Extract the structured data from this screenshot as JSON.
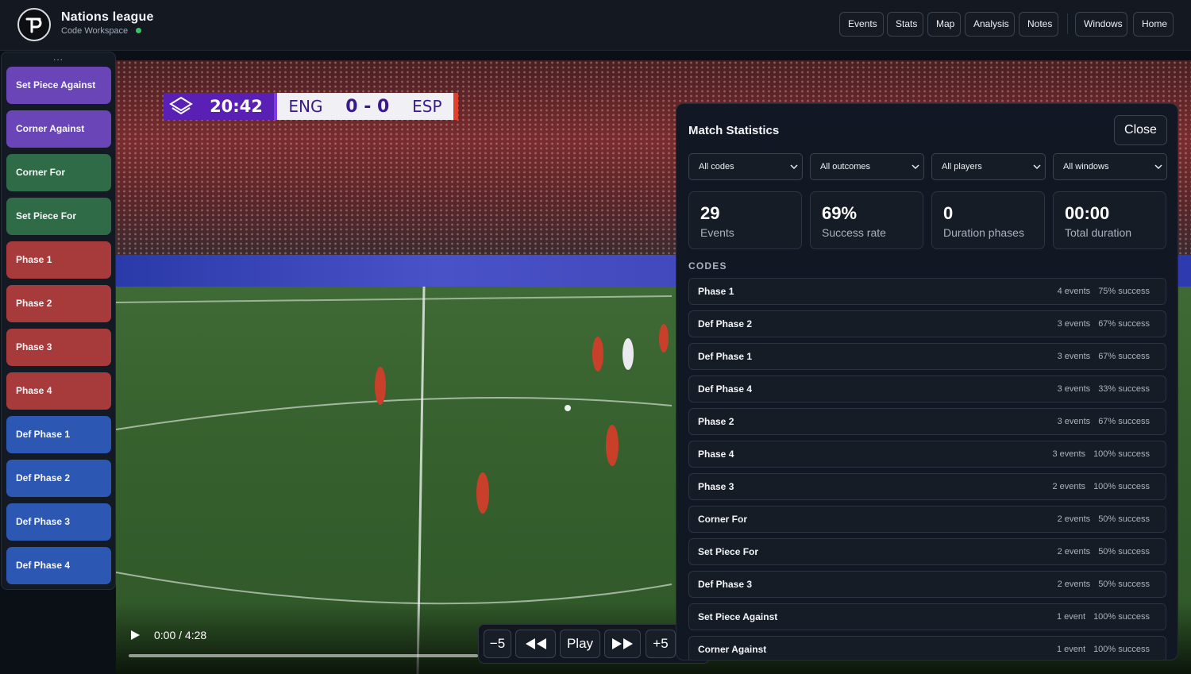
{
  "app": {
    "title": "Nations league",
    "subtitle": "Code Workspace"
  },
  "nav": [
    "Events",
    "Stats",
    "Map",
    "Analysis",
    "Notes",
    "Windows",
    "Home"
  ],
  "sidebar": {
    "handle": "...",
    "items": [
      {
        "label": "Set Piece Against",
        "color": "#6a45b8"
      },
      {
        "label": "Corner Against",
        "color": "#6a45b8"
      },
      {
        "label": "Corner For",
        "color": "#2f6b47"
      },
      {
        "label": "Set Piece For",
        "color": "#2f6b47"
      },
      {
        "label": "Phase 1",
        "color": "#a73b3b"
      },
      {
        "label": "Phase 2",
        "color": "#a73b3b"
      },
      {
        "label": "Phase 3",
        "color": "#a73b3b"
      },
      {
        "label": "Phase 4",
        "color": "#a73b3b"
      },
      {
        "label": "Def Phase 1",
        "color": "#2c58b4"
      },
      {
        "label": "Def Phase 2",
        "color": "#2c58b4"
      },
      {
        "label": "Def Phase 3",
        "color": "#2c58b4"
      },
      {
        "label": "Def Phase 4",
        "color": "#2c58b4"
      }
    ]
  },
  "video": {
    "scoreboard": {
      "clock": "20:42",
      "home": "ENG",
      "score": "0 - 0",
      "away": "ESP"
    },
    "time": "0:00 / 4:28",
    "controls": {
      "back": "−5",
      "play": "Play",
      "forward": "+5"
    }
  },
  "stats": {
    "title": "Match Statistics",
    "close": "Close",
    "filters": [
      "All codes",
      "All outcomes",
      "All players",
      "All windows"
    ],
    "cards": [
      {
        "value": "29",
        "label": "Events"
      },
      {
        "value": "69%",
        "label": "Success rate"
      },
      {
        "value": "0",
        "label": "Duration phases"
      },
      {
        "value": "00:00",
        "label": "Total duration"
      }
    ],
    "codes_header": "CODES",
    "codes": [
      {
        "name": "Phase 1",
        "events": "4 events",
        "success": "75% success"
      },
      {
        "name": "Def Phase 2",
        "events": "3 events",
        "success": "67% success"
      },
      {
        "name": "Def Phase 1",
        "events": "3 events",
        "success": "67% success"
      },
      {
        "name": "Def Phase 4",
        "events": "3 events",
        "success": "33% success"
      },
      {
        "name": "Phase 2",
        "events": "3 events",
        "success": "67% success"
      },
      {
        "name": "Phase 4",
        "events": "3 events",
        "success": "100% success"
      },
      {
        "name": "Phase 3",
        "events": "2 events",
        "success": "100% success"
      },
      {
        "name": "Corner For",
        "events": "2 events",
        "success": "50% success"
      },
      {
        "name": "Set Piece For",
        "events": "2 events",
        "success": "50% success"
      },
      {
        "name": "Def Phase 3",
        "events": "2 events",
        "success": "50% success"
      },
      {
        "name": "Set Piece Against",
        "events": "1 event",
        "success": "100% success"
      },
      {
        "name": "Corner Against",
        "events": "1 event",
        "success": "100% success"
      }
    ]
  }
}
